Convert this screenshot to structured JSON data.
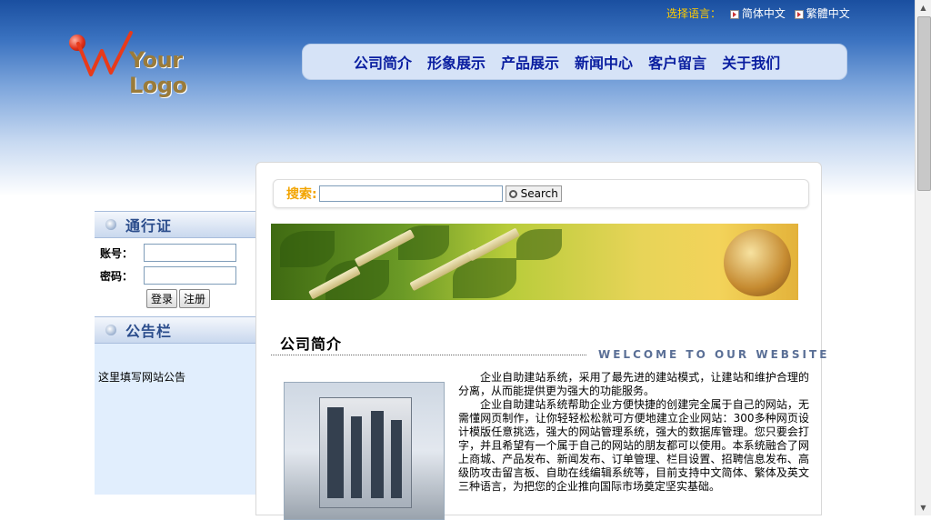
{
  "lang": {
    "label": "选择语言：",
    "options": [
      "简体中文",
      "繁體中文"
    ]
  },
  "logo": {
    "text": "Your Logo"
  },
  "nav": [
    "公司简介",
    "形象展示",
    "产品展示",
    "新闻中心",
    "客户留言",
    "关于我们"
  ],
  "login": {
    "title": "通行证",
    "account_label": "账号：",
    "password_label": "密码：",
    "login_button": "登录",
    "register_button": "注册"
  },
  "notice": {
    "title": "公告栏",
    "text": "这里填写网站公告"
  },
  "search": {
    "label": "搜索:",
    "button": "Search"
  },
  "section": {
    "title": "公司简介",
    "welcome": "WELCOME TO OUR WEBSITE",
    "para1": "企业自助建站系统，采用了最先进的建站模式，让建站和维护合理的分离，从而能提供更为强大的功能服务。",
    "para2": "企业自助建站系统帮助企业方便快捷的创建完全属于自己的网站，无需懂网页制作，让你轻轻松松就可方便地建立企业网站：300多种网页设计模版任意挑选，强大的网站管理系统，强大的数据库管理。您只要会打字，并且希望有一个属于自己的网站的朋友都可以使用。本系统融合了网上商城、产品发布、新闻发布、订单管理、栏目设置、招聘信息发布、高级防攻击留言板、自助在线编辑系统等，目前支持中文简体、繁体及英文三种语言，为把您的企业推向国际市场奠定坚实基础。"
  }
}
